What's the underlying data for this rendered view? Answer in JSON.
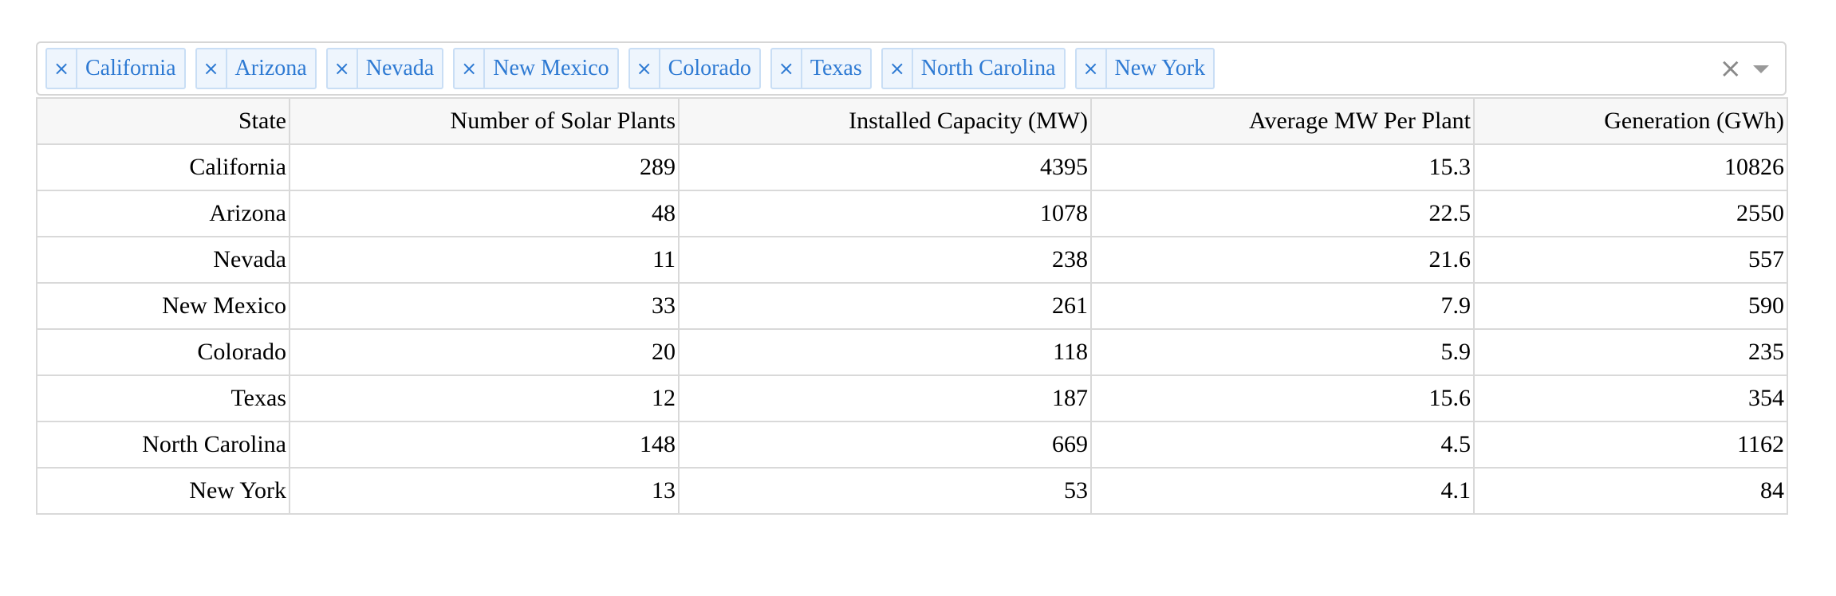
{
  "filter": {
    "chips": [
      {
        "label": "California"
      },
      {
        "label": "Arizona"
      },
      {
        "label": "Nevada"
      },
      {
        "label": "New Mexico"
      },
      {
        "label": "Colorado"
      },
      {
        "label": "Texas"
      },
      {
        "label": "North Carolina"
      },
      {
        "label": "New York"
      }
    ],
    "remove_glyph": "×",
    "clear_glyph": "×"
  },
  "table": {
    "columns": [
      "State",
      "Number of Solar Plants",
      "Installed Capacity (MW)",
      "Average MW Per Plant",
      "Generation (GWh)"
    ],
    "rows": [
      [
        "California",
        "289",
        "4395",
        "15.3",
        "10826"
      ],
      [
        "Arizona",
        "48",
        "1078",
        "22.5",
        "2550"
      ],
      [
        "Nevada",
        "11",
        "238",
        "21.6",
        "557"
      ],
      [
        "New Mexico",
        "33",
        "261",
        "7.9",
        "590"
      ],
      [
        "Colorado",
        "20",
        "118",
        "5.9",
        "235"
      ],
      [
        "Texas",
        "12",
        "187",
        "15.6",
        "354"
      ],
      [
        "North Carolina",
        "148",
        "669",
        "4.5",
        "1162"
      ],
      [
        "New York",
        "13",
        "53",
        "4.1",
        "84"
      ]
    ]
  },
  "colors": {
    "chip_text": "#2e7ad3",
    "chip_bg": "#eef5fd",
    "chip_border": "#c9def5",
    "header_bg": "#f7f7f7",
    "grid": "#d9d9d9"
  }
}
